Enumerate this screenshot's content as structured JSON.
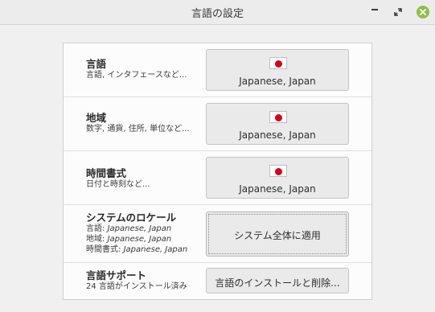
{
  "window": {
    "title": "言語の設定"
  },
  "rows": [
    {
      "title": "言語",
      "subtitle": "言語, インタフェースなど...",
      "button_label": "Japanese, Japan"
    },
    {
      "title": "地域",
      "subtitle": "数字, 通貨, 住所, 単位など...",
      "button_label": "Japanese, Japan"
    },
    {
      "title": "時間書式",
      "subtitle": "日付と時刻など...",
      "button_label": "Japanese, Japan"
    }
  ],
  "system_locale": {
    "title": "システムのロケール",
    "lines": [
      {
        "key": "言語: ",
        "value": "Japanese, Japan"
      },
      {
        "key": "地域: ",
        "value": "Japanese, Japan"
      },
      {
        "key": "時間書式: ",
        "value": "Japanese, Japan"
      }
    ],
    "button_label": "システム全体に適用"
  },
  "language_support": {
    "title": "言語サポート",
    "subtitle": "24 言語がインストール済み",
    "button_label": "言語のインストールと削除..."
  },
  "icons": {
    "flag": "japan-flag-icon",
    "minimize": "minimize-icon",
    "maximize": "maximize-icon",
    "close": "close-icon"
  },
  "colors": {
    "flag_red": "#d7001a",
    "close_green": "#8fbf4a"
  }
}
